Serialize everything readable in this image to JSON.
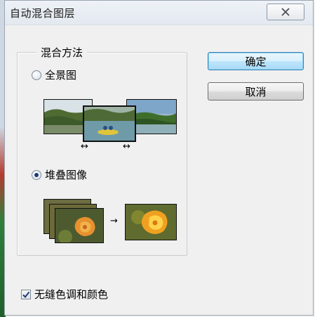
{
  "window": {
    "title": "自动混合图层"
  },
  "blend_method": {
    "legend": "混合方法",
    "options": [
      {
        "label": "全景图",
        "selected": false
      },
      {
        "label": "堆叠图像",
        "selected": true
      }
    ]
  },
  "buttons": {
    "ok": "确定",
    "cancel": "取消"
  },
  "seamless": {
    "label": "无缝色调和颜色",
    "checked": true
  },
  "colors": {
    "default_button_border": "#3c7fb1",
    "radio_dot": "#1f3b73"
  }
}
